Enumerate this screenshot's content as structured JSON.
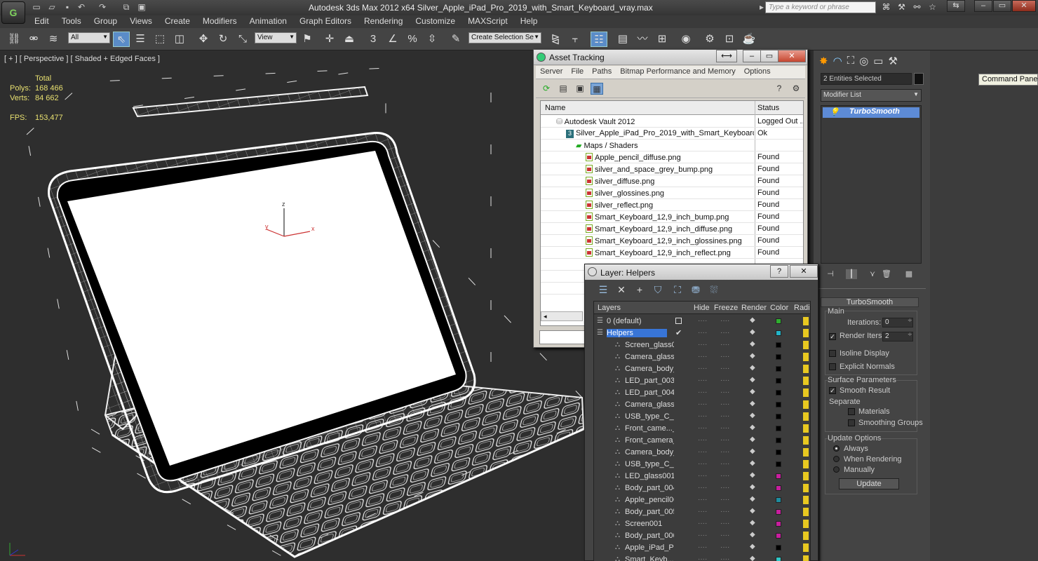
{
  "window": {
    "title": "Autodesk 3ds Max  2012 x64     Silver_Apple_iPad_Pro_2019_with_Smart_Keyboard_vray.max",
    "search_placeholder": "Type a keyword or phrase"
  },
  "menu": [
    "Edit",
    "Tools",
    "Group",
    "Views",
    "Create",
    "Modifiers",
    "Animation",
    "Graph Editors",
    "Rendering",
    "Customize",
    "MAXScript",
    "Help"
  ],
  "toolbar": {
    "filter_value": "All",
    "view_value": "View",
    "selection_set_placeholder": "Create Selection Se",
    "snap_3": "3",
    "snap_pct": "%"
  },
  "viewport": {
    "label": "[ + ] [ Perspective ] [ Shaded + Edged Faces ]",
    "stats": {
      "header": "Total",
      "polys_label": "Polys:",
      "polys_value": "168 466",
      "verts_label": "Verts:",
      "verts_value": "84 662",
      "fps_label": "FPS:",
      "fps_value": "153,477"
    },
    "gizmo": {
      "x": "x",
      "y": "y",
      "z": "z"
    }
  },
  "asset_tracking": {
    "title": "Asset Tracking",
    "menu": [
      "Server",
      "File",
      "Paths",
      "Bitmap Performance and Memory",
      "Options"
    ],
    "columns": {
      "name": "Name",
      "status": "Status"
    },
    "rows": [
      {
        "name": "Autodesk Vault 2012",
        "status": "Logged Out ..."
      },
      {
        "name": "Silver_Apple_iPad_Pro_2019_with_Smart_Keyboard_v...",
        "status": "Ok",
        "badge": "3"
      },
      {
        "name": "Maps / Shaders",
        "status": ""
      },
      {
        "name": "Apple_pencil_diffuse.png",
        "status": "Found"
      },
      {
        "name": "silver_and_space_grey_bump.png",
        "status": "Found"
      },
      {
        "name": "silver_diffuse.png",
        "status": "Found"
      },
      {
        "name": "silver_glossines.png",
        "status": "Found"
      },
      {
        "name": "silver_reflect.png",
        "status": "Found"
      },
      {
        "name": "Smart_Keyboard_12,9_inch_bump.png",
        "status": "Found"
      },
      {
        "name": "Smart_Keyboard_12,9_inch_diffuse.png",
        "status": "Found"
      },
      {
        "name": "Smart_Keyboard_12,9_inch_glossines.png",
        "status": "Found"
      },
      {
        "name": "Smart_Keyboard_12,9_inch_reflect.png",
        "status": "Found"
      }
    ]
  },
  "layer_manager": {
    "title": "Layer: Helpers",
    "help": "?",
    "close": "✕",
    "columns": {
      "layers": "Layers",
      "hide": "Hide",
      "freeze": "Freeze",
      "render": "Render",
      "color": "Color",
      "radio": "Radio"
    },
    "rows": [
      {
        "name": "0 (default)",
        "color": "#2fae2f"
      },
      {
        "name": "Helpers",
        "color": "#23b4c8"
      },
      {
        "name": "Screen_glass001",
        "color": "#000000"
      },
      {
        "name": "Camera_glass_p",
        "color": "#000000"
      },
      {
        "name": "Camera_body_p",
        "color": "#000000"
      },
      {
        "name": "LED_part_003",
        "color": "#000000"
      },
      {
        "name": "LED_part_004",
        "color": "#000000"
      },
      {
        "name": "Camera_glass_p",
        "color": "#000000"
      },
      {
        "name": "USB_type_C_par",
        "color": "#000000"
      },
      {
        "name": "Front_came..._s_",
        "color": "#000000"
      },
      {
        "name": "Front_camera_b",
        "color": "#000000"
      },
      {
        "name": "Camera_body_p",
        "color": "#000000"
      },
      {
        "name": "USB_type_C_par",
        "color": "#000000"
      },
      {
        "name": "LED_glass001",
        "color": "#c81e9e"
      },
      {
        "name": "Body_part_004",
        "color": "#c81e9e"
      },
      {
        "name": "Apple_pencil001",
        "color": "#1e8c9e"
      },
      {
        "name": "Body_part_005",
        "color": "#c81e9e"
      },
      {
        "name": "Screen001",
        "color": "#c81e9e"
      },
      {
        "name": "Body_part_006",
        "color": "#c81e9e"
      },
      {
        "name": "Apple_iPad_Pro_",
        "color": "#000000"
      },
      {
        "name": "Smart_Keyb..._S",
        "color": "#2ec8c8"
      }
    ]
  },
  "command_panel": {
    "tooltip": "Command Panel",
    "selection": "2 Entities Selected",
    "modifier_list": "Modifier List",
    "modifier": "TurboSmooth",
    "rollout": "TurboSmooth",
    "main": {
      "label": "Main",
      "iterations_label": "Iterations:",
      "iterations_value": "0",
      "render_iters_label": "Render Iters:",
      "render_iters_value": "2",
      "isoline": "Isoline Display",
      "explicit": "Explicit Normals"
    },
    "surface": {
      "label": "Surface Parameters",
      "smooth": "Smooth Result",
      "separate": "Separate",
      "materials": "Materials",
      "smoothing": "Smoothing Groups"
    },
    "update": {
      "label": "Update Options",
      "always": "Always",
      "rendering": "When Rendering",
      "manually": "Manually",
      "button": "Update"
    }
  }
}
